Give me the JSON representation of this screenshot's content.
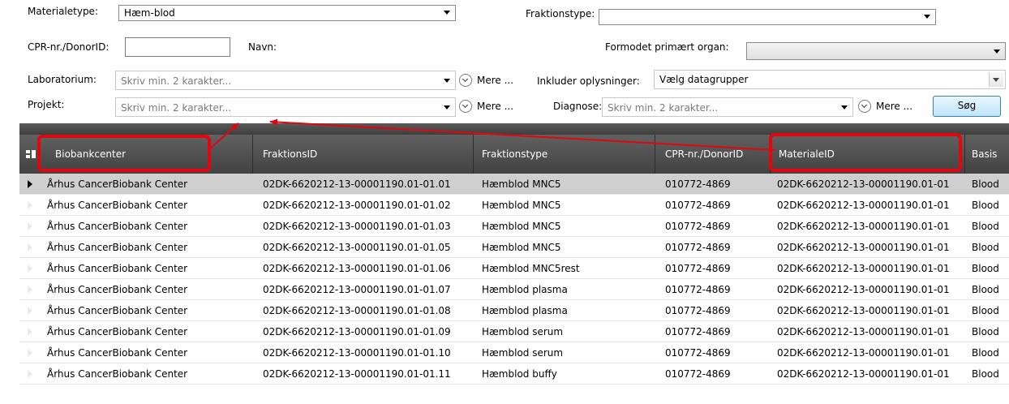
{
  "filters": {
    "materialetype": {
      "label": "Materialetype:",
      "value": "Hæm-blod"
    },
    "fraktionstype": {
      "label": "Fraktionstype:",
      "value": ""
    },
    "cpr": {
      "label": "CPR-nr./DonorID:",
      "value": ""
    },
    "navn": {
      "label": "Navn:"
    },
    "formodet": {
      "label": "Formodet primært organ:",
      "value": ""
    },
    "laboratorium": {
      "label": "Laboratorium:",
      "placeholder": "Skriv min. 2 karakter..."
    },
    "projekt": {
      "label": "Projekt:",
      "placeholder": "Skriv min. 2 karakter..."
    },
    "diagnose": {
      "label": "Diagnose:",
      "placeholder": "Skriv min. 2 karakter..."
    },
    "inkluder": {
      "label": "Inkluder oplysninger:",
      "value": "Vælg datagrupper"
    },
    "mere_label": "Mere ...",
    "search_label": "Søg"
  },
  "grid": {
    "columns": [
      "Biobankcenter",
      "FraktionsID",
      "Fraktionstype",
      "CPR-nr./DonorID",
      "MaterialeID",
      "Basis"
    ],
    "rows": [
      [
        "Århus CancerBiobank Center",
        "02DK-6620212-13-00001190.01-01.01",
        "Hæmblod MNC5",
        "010772-4869",
        "02DK-6620212-13-00001190.01-01",
        "Blood"
      ],
      [
        "Århus CancerBiobank Center",
        "02DK-6620212-13-00001190.01-01.02",
        "Hæmblod MNC5",
        "010772-4869",
        "02DK-6620212-13-00001190.01-01",
        "Blood"
      ],
      [
        "Århus CancerBiobank Center",
        "02DK-6620212-13-00001190.01-01.03",
        "Hæmblod MNC5",
        "010772-4869",
        "02DK-6620212-13-00001190.01-01",
        "Blood"
      ],
      [
        "Århus CancerBiobank Center",
        "02DK-6620212-13-00001190.01-01.05",
        "Hæmblod MNC5",
        "010772-4869",
        "02DK-6620212-13-00001190.01-01",
        "Blood"
      ],
      [
        "Århus CancerBiobank Center",
        "02DK-6620212-13-00001190.01-01.06",
        "Hæmblod MNC5rest",
        "010772-4869",
        "02DK-6620212-13-00001190.01-01",
        "Blood"
      ],
      [
        "Århus CancerBiobank Center",
        "02DK-6620212-13-00001190.01-01.07",
        "Hæmblod plasma",
        "010772-4869",
        "02DK-6620212-13-00001190.01-01",
        "Blood"
      ],
      [
        "Århus CancerBiobank Center",
        "02DK-6620212-13-00001190.01-01.08",
        "Hæmblod plasma",
        "010772-4869",
        "02DK-6620212-13-00001190.01-01",
        "Blood"
      ],
      [
        "Århus CancerBiobank Center",
        "02DK-6620212-13-00001190.01-01.09",
        "Hæmblod serum",
        "010772-4869",
        "02DK-6620212-13-00001190.01-01",
        "Blood"
      ],
      [
        "Århus CancerBiobank Center",
        "02DK-6620212-13-00001190.01-01.10",
        "Hæmblod serum",
        "010772-4869",
        "02DK-6620212-13-00001190.01-01",
        "Blood"
      ],
      [
        "Århus CancerBiobank Center",
        "02DK-6620212-13-00001190.01-01.11",
        "Hæmblod buffy",
        "010772-4869",
        "02DK-6620212-13-00001190.01-01",
        "Blood"
      ]
    ]
  },
  "annotation_color": "#e2060f"
}
